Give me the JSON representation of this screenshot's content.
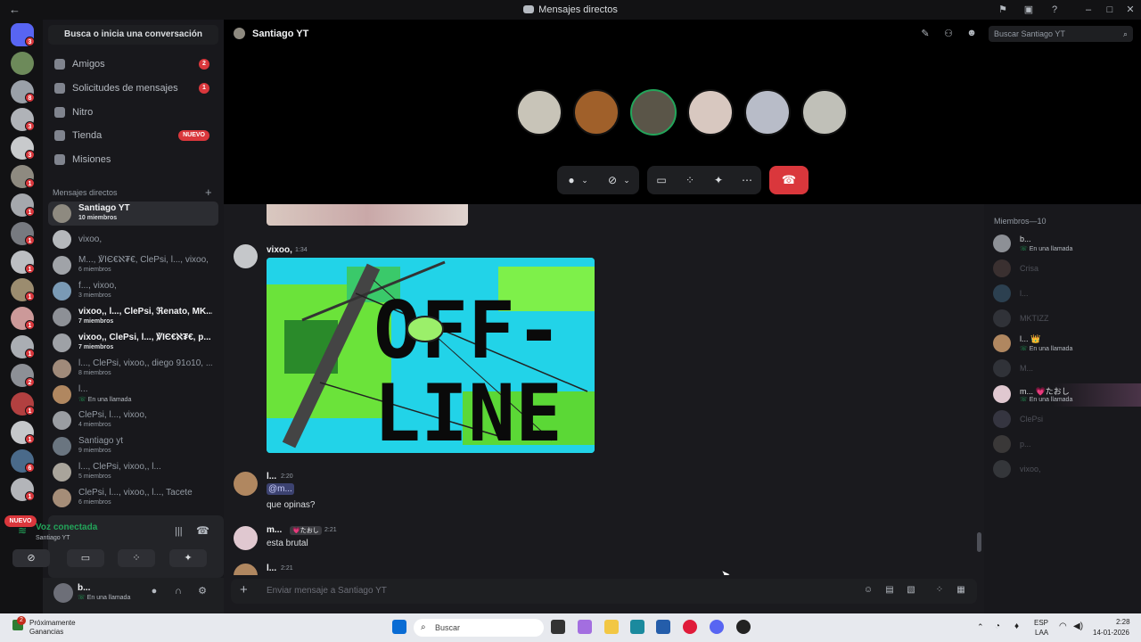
{
  "titlebar": {
    "title": "Mensajes directos",
    "back": "←"
  },
  "rail": {
    "new_badge": "NUEVO",
    "badges": [
      "3",
      "8",
      "3",
      "3",
      "1",
      "1",
      "1",
      "1",
      "1",
      "1",
      "1",
      "1",
      "1",
      "2",
      "1",
      "1",
      "1",
      "6",
      "1"
    ]
  },
  "sidebar": {
    "search_placeholder": "Busca o inicia una conversación",
    "nav": [
      {
        "label": "Amigos",
        "badge": "2"
      },
      {
        "label": "Solicitudes de mensajes",
        "badge": "1"
      },
      {
        "label": "Nitro",
        "badge": ""
      },
      {
        "label": "Tienda",
        "badge": "NUEVO"
      },
      {
        "label": "Misiones",
        "badge": ""
      }
    ],
    "dm_header": "Mensajes directos",
    "dms": [
      {
        "name": "Santiago YT",
        "sub": "10 miembros"
      },
      {
        "name": "vixoo,",
        "sub": ""
      },
      {
        "name": "M..., ℣ÎЄ€ℵ₮€, ClePsi, l..., vixoo,",
        "sub": "6 miembros"
      },
      {
        "name": "f..., vixoo,",
        "sub": "3 miembros"
      },
      {
        "name": "vixoo,, l..., ClePsi, ℜenato, MK...",
        "sub": "7 miembros"
      },
      {
        "name": "vixoo,, ClePsi, l..., ℣ÎЄ€ℵ₮€, p...",
        "sub": "7 miembros"
      },
      {
        "name": "l..., ClePsi, vixoo,, diego 91o10, ...",
        "sub": "8 miembros"
      },
      {
        "name": "l...",
        "sub": "En una llamada"
      },
      {
        "name": "ClePsi, l..., vixoo,",
        "sub": "4 miembros"
      },
      {
        "name": "Santiago yt",
        "sub": "9 miembros"
      },
      {
        "name": "l..., ClePsi, vixoo,, l...",
        "sub": "5 miembros"
      },
      {
        "name": "ClePsi, l..., vixoo,, l..., Tacete",
        "sub": "6 miembros"
      }
    ]
  },
  "voice": {
    "status": "Voz conectada",
    "channel": "Santiago YT"
  },
  "user": {
    "name": "b...",
    "status": "En una llamada"
  },
  "call": {
    "title": "Santiago YT",
    "search_placeholder": "Buscar Santiago YT"
  },
  "messages": {
    "m1": {
      "author": "vixoo,",
      "time": "1:34"
    },
    "offline_text_1": "OFF-",
    "offline_text_2": "LINE",
    "m2": {
      "author": "l...",
      "time": "2:20",
      "mention": "@m...",
      "text": "que opinas?"
    },
    "m3": {
      "author": "m...",
      "tag": "💗たおし",
      "time": "2:21",
      "text": "esta brutal"
    },
    "m4": {
      "author": "l...",
      "time": "2:21"
    }
  },
  "composer": {
    "placeholder": "Enviar mensaje a Santiago YT",
    "plus": "+"
  },
  "members": {
    "header": "Miembros—10",
    "list": [
      {
        "name": "b...",
        "sub": "En una llamada"
      },
      {
        "name": "Crisa",
        "sub": ""
      },
      {
        "name": "l...",
        "sub": ""
      },
      {
        "name": "MKTIZZ",
        "sub": ""
      },
      {
        "name": "l... 👑",
        "sub": "En una llamada"
      },
      {
        "name": "M...",
        "sub": ""
      },
      {
        "name": "m... 💗たおし",
        "sub": "En una llamada"
      },
      {
        "name": "ClePsi",
        "sub": ""
      },
      {
        "name": "p...",
        "sub": ""
      },
      {
        "name": "vixoo,",
        "sub": ""
      }
    ]
  },
  "taskbar": {
    "notice_title": "Próximamente",
    "notice_sub": "Ganancias",
    "notice_badge": "2",
    "search": "Buscar",
    "lang": "ESP",
    "lang_sub": "LAA",
    "time": "2:28",
    "date": "14-01-2026"
  },
  "colors": {
    "accent": "#23a55a",
    "danger": "#da373c",
    "mention_bg": "#3c4270"
  }
}
